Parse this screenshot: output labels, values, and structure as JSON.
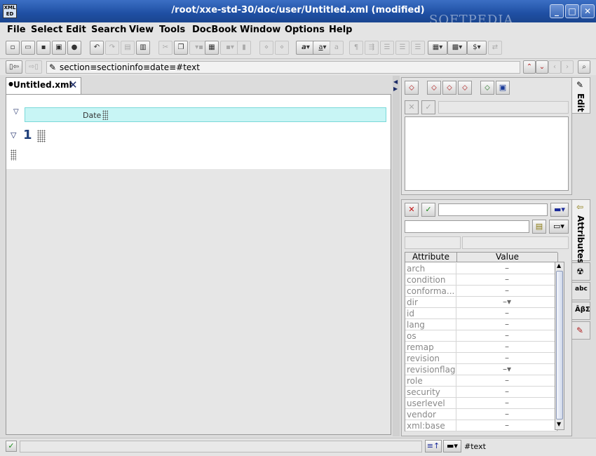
{
  "window": {
    "title": "/root/xxe-std-30/doc/user/Untitled.xml (modified)",
    "logo_text": "XML ED",
    "watermark": "SOFTPEDIA",
    "minimize": "_",
    "maximize": "□",
    "close": "✕"
  },
  "menu": [
    "File",
    "Select",
    "Edit",
    "Search",
    "View",
    "Tools",
    "DocBook",
    "Window",
    "Options",
    "Help"
  ],
  "pathbar": {
    "path": "section≡sectioninfo≡date≡#text"
  },
  "editor": {
    "tab_label": "Untitled.xml",
    "date_label": "Date",
    "section_number": "1"
  },
  "side_tabs": {
    "edit": "Edit",
    "attributes": "Attributes"
  },
  "attributes": {
    "col_attribute": "Attribute",
    "col_value": "Value",
    "rows": [
      {
        "name": "arch",
        "value": "–"
      },
      {
        "name": "condition",
        "value": "–"
      },
      {
        "name": "conforma...",
        "value": "–"
      },
      {
        "name": "dir",
        "value": "–▾"
      },
      {
        "name": "id",
        "value": "–"
      },
      {
        "name": "lang",
        "value": "–"
      },
      {
        "name": "os",
        "value": "–"
      },
      {
        "name": "remap",
        "value": "–"
      },
      {
        "name": "revision",
        "value": "–"
      },
      {
        "name": "revisionflag",
        "value": "–▾"
      },
      {
        "name": "role",
        "value": "–"
      },
      {
        "name": "security",
        "value": "–"
      },
      {
        "name": "userlevel",
        "value": "–"
      },
      {
        "name": "vendor",
        "value": "–"
      },
      {
        "name": "xml:base",
        "value": "–"
      }
    ]
  },
  "status": {
    "node_text": "#text"
  },
  "colors": {
    "titlebar": "#1f4fa3",
    "date_field": "#c8f5f5",
    "section_number": "#1f3f7a"
  }
}
